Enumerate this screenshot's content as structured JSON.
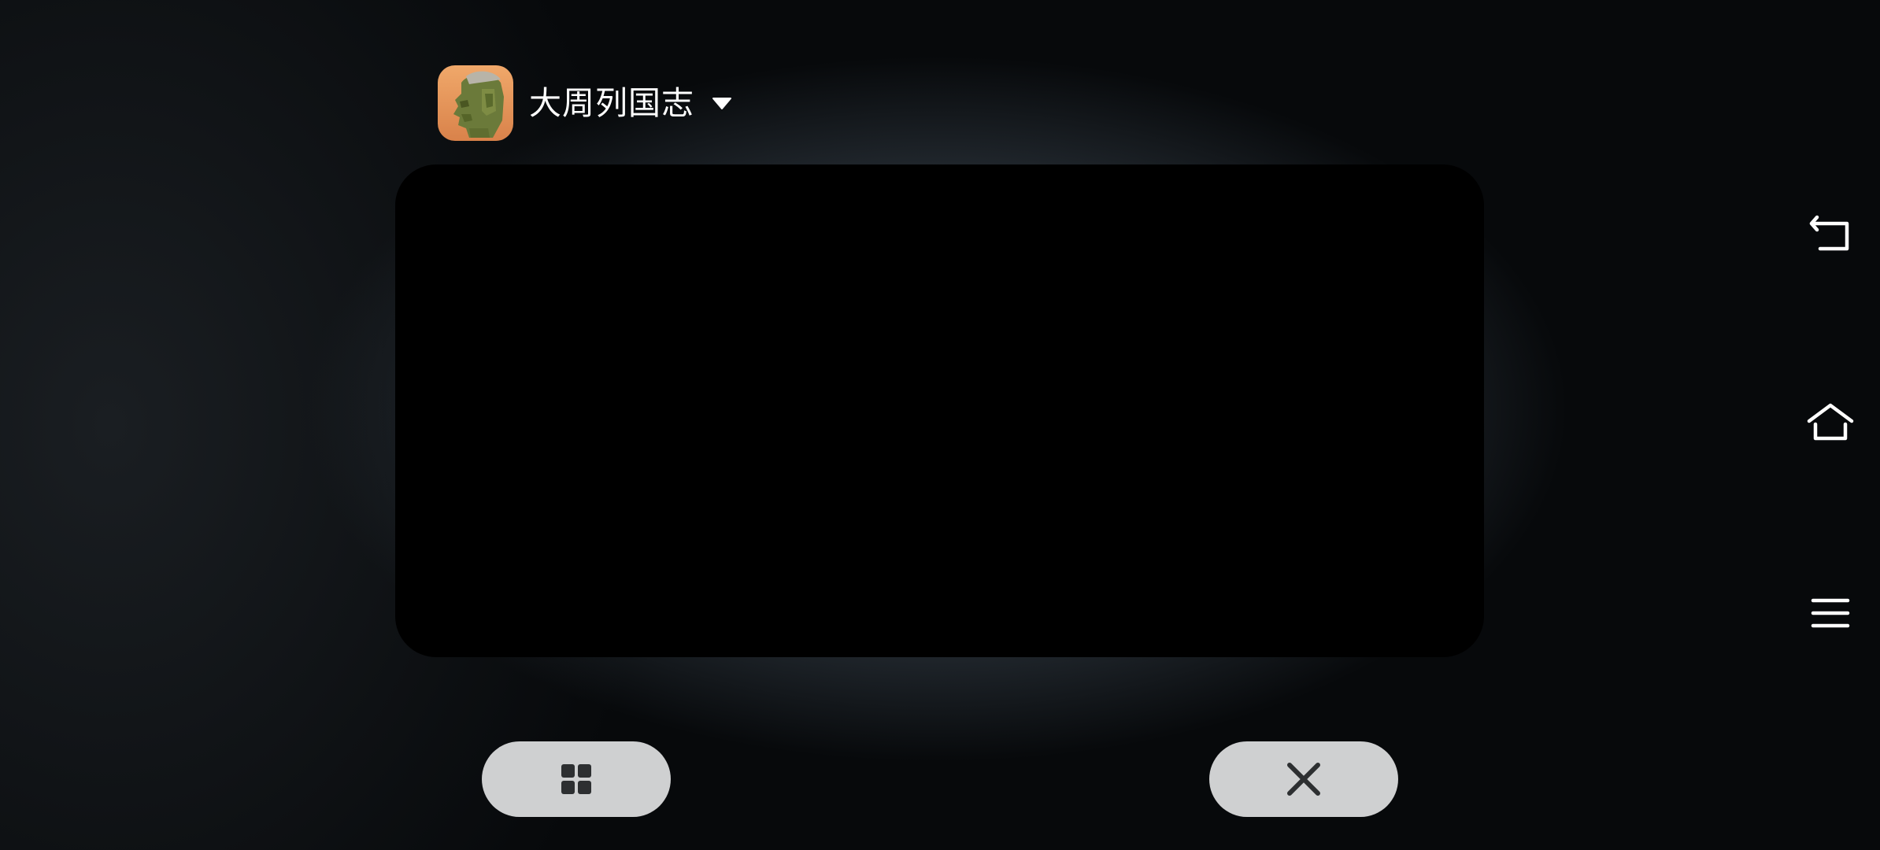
{
  "app": {
    "title": "大周列国志",
    "icon": "app-icon-bronze-warrior-head"
  },
  "controls": {
    "dropdown_icon": "caret-down-icon",
    "split_screen_icon": "grid-icon",
    "close_icon": "close-icon"
  },
  "nav": {
    "back_icon": "back-icon",
    "home_icon": "home-icon",
    "menu_icon": "menu-icon"
  },
  "colors": {
    "background": "#14191e",
    "preview": "#000000",
    "pill": "#cfd0d1",
    "pill_glyph": "#2d2f31",
    "text": "#ffffff"
  }
}
